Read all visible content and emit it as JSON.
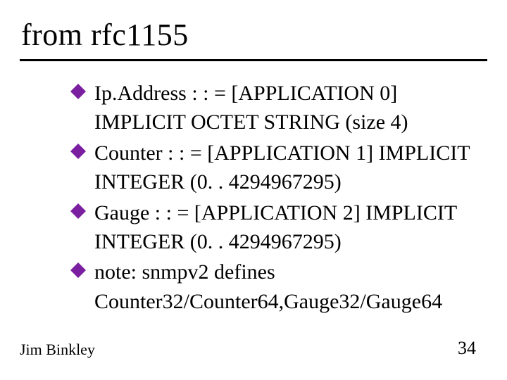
{
  "colors": {
    "bullet": "#7a1fa0"
  },
  "title": "from rfc1155",
  "items": [
    {
      "lead": "Ip.Address",
      "rest": " : : = [APPLICATION 0] IMPLICIT OCTET STRING (size 4)"
    },
    {
      "lead": "Counter",
      "rest": " : : = [APPLICATION 1] IMPLICIT INTEGER (0. . 4294967295)"
    },
    {
      "lead": "Gauge",
      "rest": " : : = [APPLICATION 2] IMPLICIT INTEGER (0. . 4294967295)"
    },
    {
      "lead": "note:",
      "rest": " snmpv2 defines Counter32/Counter64,Gauge32/Gauge64"
    }
  ],
  "footer": {
    "author": "Jim Binkley",
    "page": "34"
  }
}
